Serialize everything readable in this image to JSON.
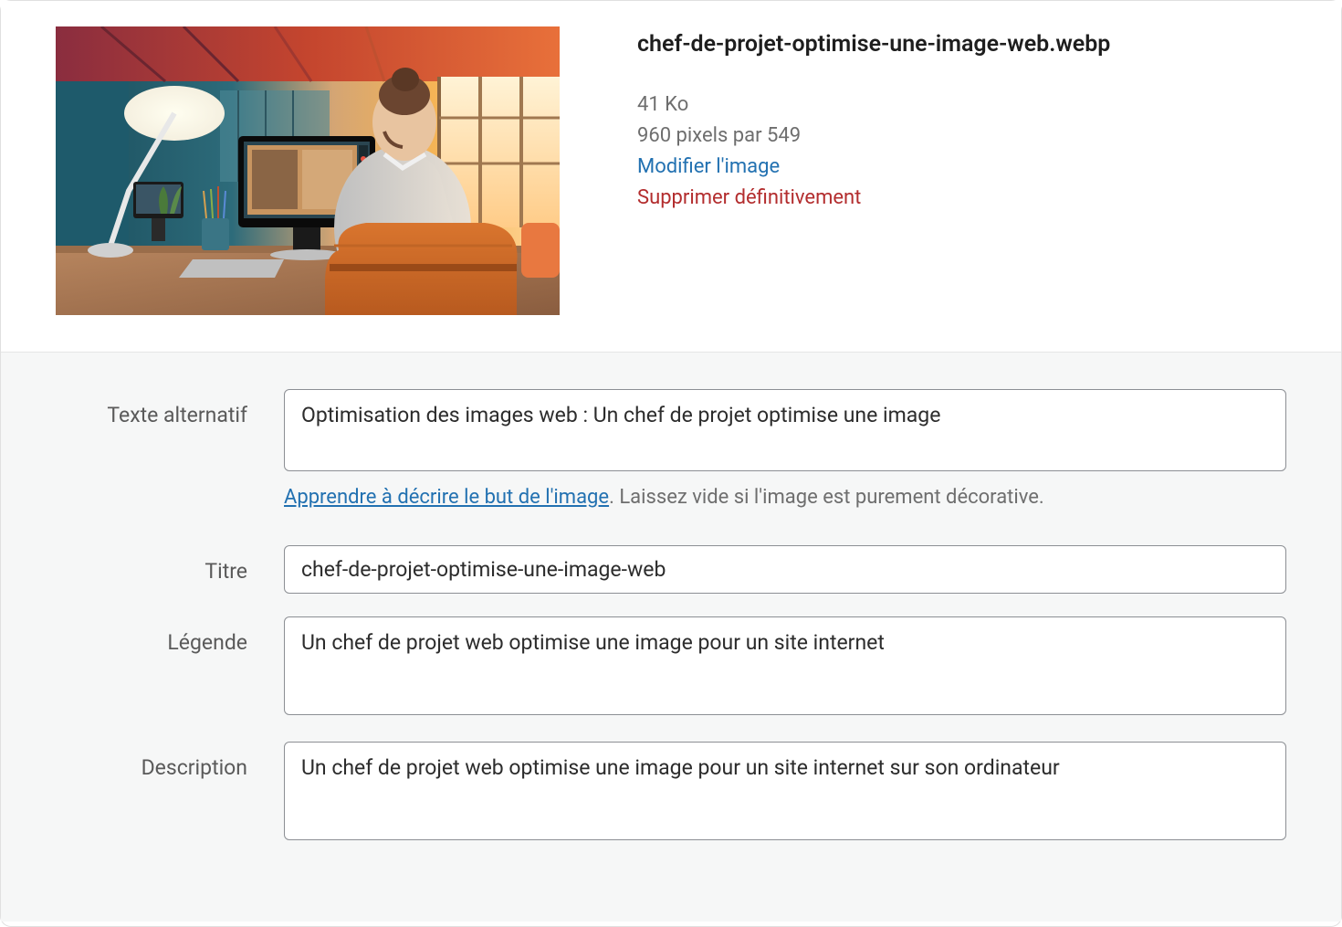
{
  "media": {
    "filename": "chef-de-projet-optimise-une-image-web.webp",
    "filesize": "41 Ko",
    "dimensions": "960 pixels par 549",
    "edit_label": "Modifier l'image",
    "delete_label": "Supprimer définitivement"
  },
  "form": {
    "alt_text": {
      "label": "Texte alternatif",
      "value": "Optimisation des images web : Un chef de projet optimise une image"
    },
    "alt_help": {
      "link_text": "Apprendre à décrire le but de l'image",
      "suffix": ". Laissez vide si l'image est purement décorative."
    },
    "title": {
      "label": "Titre",
      "value": "chef-de-projet-optimise-une-image-web"
    },
    "caption": {
      "label": "Légende",
      "value": "Un chef de projet web optimise une image pour un site internet"
    },
    "description": {
      "label": "Description",
      "value": "Un chef de projet web optimise une image pour un site internet sur son ordinateur"
    }
  }
}
